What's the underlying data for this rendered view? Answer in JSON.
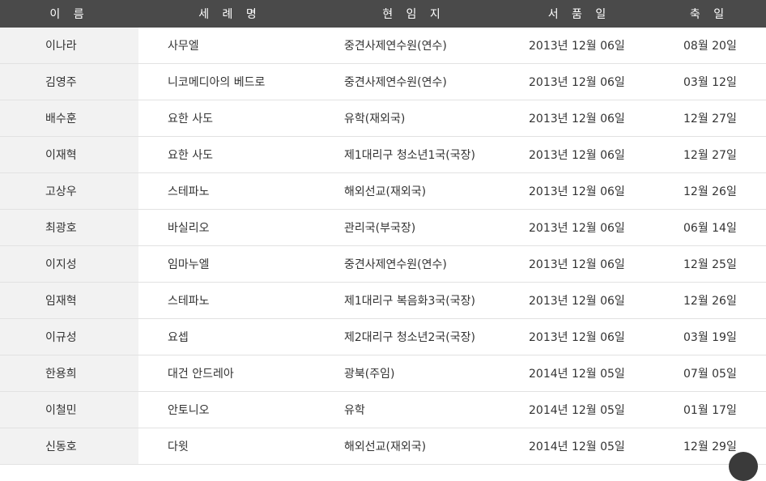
{
  "headers": {
    "name": "이 름",
    "baptismal": "세 례 명",
    "position": "현 임 지",
    "ordination": "서 품 일",
    "feast": "축 일"
  },
  "rows": [
    {
      "name": "이나라",
      "baptismal": "사무엘",
      "position": "중견사제연수원(연수)",
      "ordination": "2013년 12월 06일",
      "feast": "08월 20일"
    },
    {
      "name": "김영주",
      "baptismal": "니코메디아의 베드로",
      "position": "중견사제연수원(연수)",
      "ordination": "2013년 12월 06일",
      "feast": "03월 12일"
    },
    {
      "name": "배수훈",
      "baptismal": "요한 사도",
      "position": "유학(재외국)",
      "ordination": "2013년 12월 06일",
      "feast": "12월 27일"
    },
    {
      "name": "이재혁",
      "baptismal": "요한 사도",
      "position": "제1대리구 청소년1국(국장)",
      "ordination": "2013년 12월 06일",
      "feast": "12월 27일"
    },
    {
      "name": "고상우",
      "baptismal": "스테파노",
      "position": "해외선교(재외국)",
      "ordination": "2013년 12월 06일",
      "feast": "12월 26일"
    },
    {
      "name": "최광호",
      "baptismal": "바실리오",
      "position": "관리국(부국장)",
      "ordination": "2013년 12월 06일",
      "feast": "06월 14일"
    },
    {
      "name": "이지성",
      "baptismal": "임마누엘",
      "position": "중견사제연수원(연수)",
      "ordination": "2013년 12월 06일",
      "feast": "12월 25일"
    },
    {
      "name": "임재혁",
      "baptismal": "스테파노",
      "position": "제1대리구 복음화3국(국장)",
      "ordination": "2013년 12월 06일",
      "feast": "12월 26일"
    },
    {
      "name": "이규성",
      "baptismal": "요셉",
      "position": "제2대리구 청소년2국(국장)",
      "ordination": "2013년 12월 06일",
      "feast": "03월 19일"
    },
    {
      "name": "한용희",
      "baptismal": "대건 안드레아",
      "position": "광북(주임)",
      "ordination": "2014년 12월 05일",
      "feast": "07월 05일"
    },
    {
      "name": "이철민",
      "baptismal": "안토니오",
      "position": "유학",
      "ordination": "2014년 12월 05일",
      "feast": "01월 17일"
    },
    {
      "name": "신동호",
      "baptismal": "다윗",
      "position": "해외선교(재외국)",
      "ordination": "2014년 12월 05일",
      "feast": "12월 29일"
    }
  ]
}
